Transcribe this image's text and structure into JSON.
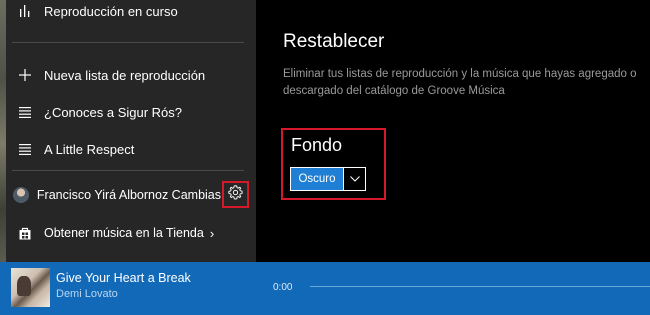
{
  "sidebar": {
    "items": [
      {
        "icon": "equalizer-icon",
        "label": "Reproducción en curso"
      },
      {
        "icon": "plus-icon",
        "label": "Nueva lista de reproducción"
      },
      {
        "icon": "playlist-icon",
        "label": "¿Conoces a Sigur Rós?"
      },
      {
        "icon": "playlist-icon",
        "label": "A Little Respect"
      }
    ],
    "user": {
      "name": "Francisco Yirá Albornoz Cambias"
    },
    "store": {
      "label": "Obtener música en la Tienda",
      "chevron": "›"
    }
  },
  "main": {
    "reset": {
      "title": "Restablecer",
      "description": "Eliminar tus listas de reproducción y la música que hayas agregado o descargado del catálogo de Groove Música"
    },
    "background": {
      "title": "Fondo",
      "selected": "Oscuro"
    }
  },
  "player": {
    "track_title": "Give Your Heart a Break",
    "artist": "Demi Lovato",
    "elapsed": "0:00"
  },
  "colors": {
    "accent": "#1e7fd4",
    "player_bar": "#1169b8",
    "highlight_box": "#d6182a",
    "sidebar_bg": "#262626"
  }
}
